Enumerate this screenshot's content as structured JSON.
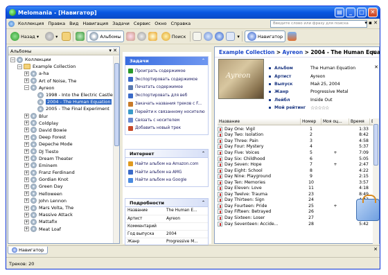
{
  "window": {
    "title": "Melomania - [Навигатор]"
  },
  "menu": {
    "items": [
      "Коллекция",
      "Правка",
      "Вид",
      "Навигация",
      "Задачи",
      "Сервис",
      "Окно",
      "Справка"
    ],
    "search_placeholder": "Введите слово или фразу для поиска"
  },
  "toolbar": {
    "back": "Назад",
    "albums": "Альбомы",
    "search": "Поиск",
    "navigator": "Навигатор"
  },
  "left_pane": {
    "title": "Альбомы",
    "tree": [
      {
        "label": "Коллекции",
        "indent": 0,
        "kind": "cd",
        "exp": "−"
      },
      {
        "label": "Example Collection",
        "indent": 1,
        "kind": "folder",
        "exp": "−"
      },
      {
        "label": "a-ha",
        "indent": 2,
        "kind": "cd",
        "exp": "+"
      },
      {
        "label": "Art of Noise, The",
        "indent": 2,
        "kind": "cd",
        "exp": "+"
      },
      {
        "label": "Ayreon",
        "indent": 2,
        "kind": "cd",
        "exp": "−"
      },
      {
        "label": "1998 - Into the Electric Castle",
        "indent": 3,
        "kind": "cd",
        "exp": ""
      },
      {
        "label": "2004 - The Human Equation",
        "indent": 3,
        "kind": "cd",
        "exp": "",
        "selected": true
      },
      {
        "label": "2005 - The Final Experiment",
        "indent": 3,
        "kind": "cd",
        "exp": ""
      },
      {
        "label": "Blur",
        "indent": 2,
        "kind": "cd",
        "exp": "+"
      },
      {
        "label": "Coldplay",
        "indent": 2,
        "kind": "cd",
        "exp": "+"
      },
      {
        "label": "David Bowie",
        "indent": 2,
        "kind": "cd",
        "exp": "+"
      },
      {
        "label": "Deep Forest",
        "indent": 2,
        "kind": "cd",
        "exp": "+"
      },
      {
        "label": "Depeche Mode",
        "indent": 2,
        "kind": "cd",
        "exp": "+"
      },
      {
        "label": "DJ Tiesto",
        "indent": 2,
        "kind": "cd",
        "exp": "+"
      },
      {
        "label": "Dream Theater",
        "indent": 2,
        "kind": "cd",
        "exp": "+"
      },
      {
        "label": "Eminem",
        "indent": 2,
        "kind": "cd",
        "exp": "+"
      },
      {
        "label": "Franz Ferdinand",
        "indent": 2,
        "kind": "cd",
        "exp": "+"
      },
      {
        "label": "Gordian Knot",
        "indent": 2,
        "kind": "cd",
        "exp": "+"
      },
      {
        "label": "Green Day",
        "indent": 2,
        "kind": "cd",
        "exp": "+"
      },
      {
        "label": "Helloween",
        "indent": 2,
        "kind": "cd",
        "exp": "+"
      },
      {
        "label": "John Lennon",
        "indent": 2,
        "kind": "cd",
        "exp": "+"
      },
      {
        "label": "Mars Volta, The",
        "indent": 2,
        "kind": "cd",
        "exp": "+"
      },
      {
        "label": "Massive Attack",
        "indent": 2,
        "kind": "cd",
        "exp": "+"
      },
      {
        "label": "Mattafix",
        "indent": 2,
        "kind": "cd",
        "exp": "+"
      },
      {
        "label": "Meat Loaf",
        "indent": 2,
        "kind": "cd",
        "exp": "+"
      }
    ]
  },
  "tasks": {
    "title": "Задачи",
    "items": [
      {
        "label": "Проиграть содержимое",
        "color": "#2a9a2a"
      },
      {
        "label": "Экспортировать содержимое",
        "color": "#3a6ac8"
      },
      {
        "label": "Печатать содержимое",
        "color": "#5a7ab0"
      },
      {
        "label": "Экспортировать для веб",
        "color": "#3a6ac8"
      },
      {
        "label": "Закачать названия треков с F...",
        "color": "#c87a2a"
      },
      {
        "label": "Перейти к связанному носителю",
        "color": "#3a9ac8"
      },
      {
        "label": "Связать с носителем",
        "color": "#6a8ad0"
      },
      {
        "label": "Добавить новый трек",
        "color": "#c84a2a"
      }
    ]
  },
  "internet": {
    "title": "Интернет",
    "items": [
      "Найти альбом на Amazon.com",
      "Найти альбом на AMG",
      "Найти альбом на Google"
    ]
  },
  "details": {
    "title": "Подробности",
    "rows": [
      [
        "Название",
        "The Human E..."
      ],
      [
        "Артист",
        "Ayreon"
      ],
      [
        "Комментарий",
        ""
      ],
      [
        "Год выпуска",
        "2004"
      ],
      [
        "Жанр",
        "Progressive M..."
      ]
    ]
  },
  "breadcrumb": {
    "collection": "Example Collection",
    "sep1": ">",
    "artist": "Ayreon",
    "sep2": ">",
    "album": "2004 - The Human Equation"
  },
  "album_cover_text": "Ayreon",
  "album_info": [
    {
      "label": "Альбом",
      "value": "The Human Equation"
    },
    {
      "label": "Артист",
      "value": "Ayreon"
    },
    {
      "label": "Выпуск",
      "value": "Май 25, 2004"
    },
    {
      "label": "Жанр",
      "value": "Progressive Metal"
    },
    {
      "label": "Лейбл",
      "value": "Inside Out"
    },
    {
      "label": "Мой рейтинг",
      "value": "☆☆☆☆☆"
    }
  ],
  "tracks": {
    "headers": [
      "Название",
      "Номер",
      "Моя оц...",
      "Время",
      "Б"
    ],
    "rows": [
      [
        "Day One: Vigil",
        "1",
        "",
        "1:33"
      ],
      [
        "Day Two: Isolation",
        "2",
        "",
        "8:42"
      ],
      [
        "Day Three: Pain",
        "3",
        "",
        "4:58"
      ],
      [
        "Day Four: Mystery",
        "4",
        "",
        "5:37"
      ],
      [
        "Day Five: Voices",
        "5",
        "+",
        "7:09"
      ],
      [
        "Day Six: Childhood",
        "6",
        "",
        "5:05"
      ],
      [
        "Day Seven: Hope",
        "7",
        "+",
        "2:47"
      ],
      [
        "Day Eight: School",
        "8",
        "",
        "4:22"
      ],
      [
        "Day Nine: Playground",
        "9",
        "",
        "2:15"
      ],
      [
        "Day Ten: Memories",
        "10",
        "",
        "3:57"
      ],
      [
        "Day Eleven: Love",
        "11",
        "",
        "4:18"
      ],
      [
        "Day Twelve: Trauma",
        "23",
        "",
        "8:49"
      ],
      [
        "Day Thirteen: Sign",
        "24",
        "",
        "4:47"
      ],
      [
        "Day Fourteen: Pride",
        "25",
        "+",
        "4:42"
      ],
      [
        "Day Fifteen: Betrayed",
        "26",
        "",
        "5:32"
      ],
      [
        "Day Sixteen: Loser",
        "27",
        "",
        "4:46"
      ],
      [
        "Day Seventeen: Accide...",
        "28",
        "",
        "5:42"
      ]
    ]
  },
  "bottom_tab": {
    "label": "Навигатор"
  },
  "status": {
    "text": "Треков: 20"
  }
}
